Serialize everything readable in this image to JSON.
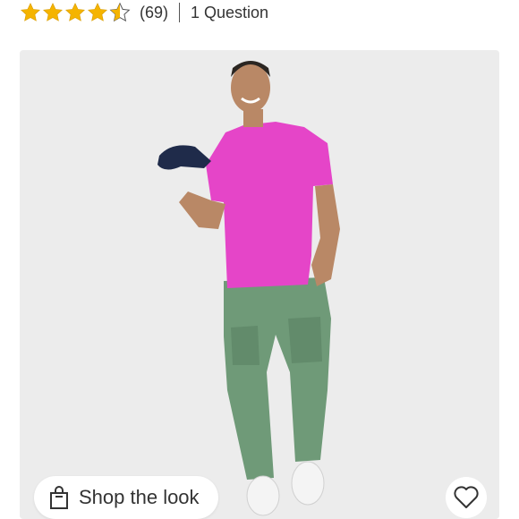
{
  "rating": {
    "value": 4.5,
    "max": 5,
    "count_text": "(69)",
    "questions_text": "1 Question",
    "star_color": "#f5b400"
  },
  "product_image": {
    "description_icon": "model-photo",
    "background": "#ececec"
  },
  "shop_the_look": {
    "label": "Shop the look",
    "icon": "shopping-bag-icon"
  },
  "favorite": {
    "icon": "heart-icon"
  }
}
